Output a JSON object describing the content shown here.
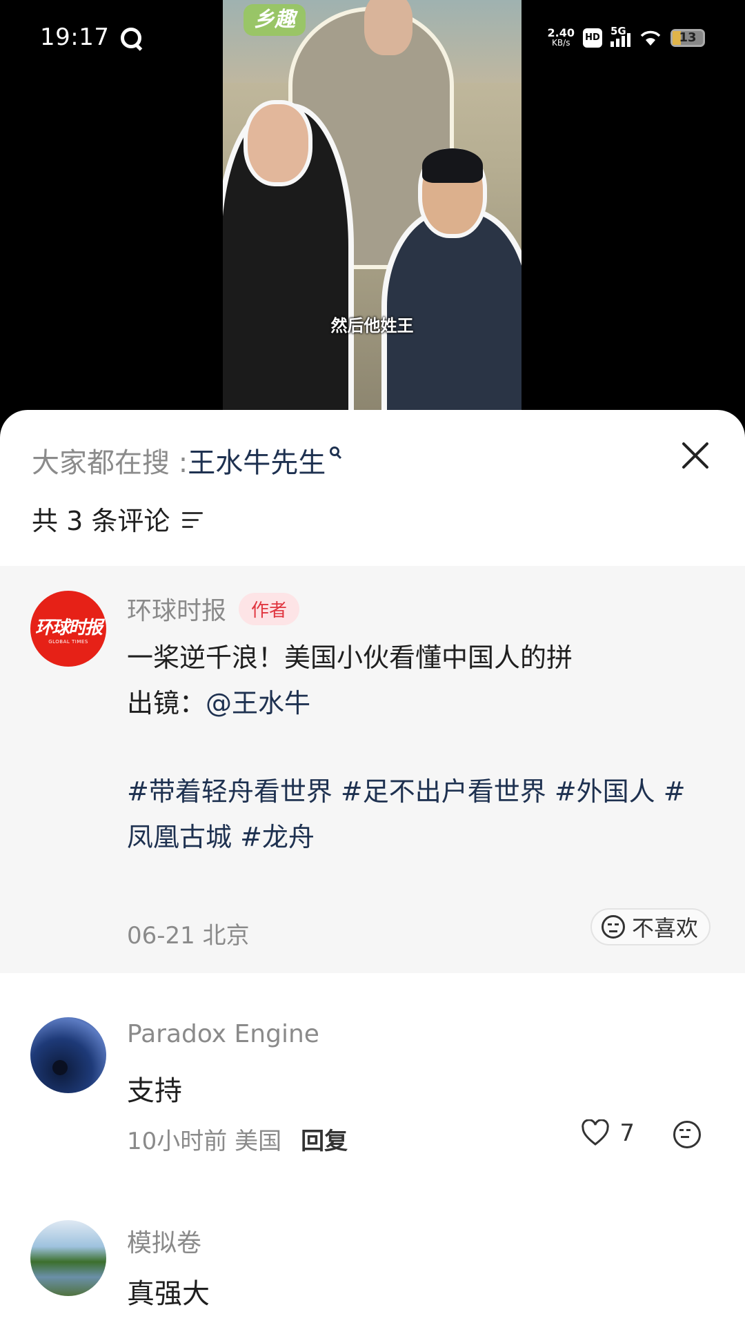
{
  "status_bar": {
    "time": "19:17",
    "net_speed_value": "2.40",
    "net_speed_unit": "KB/s",
    "hd": "HD",
    "network": "5G",
    "battery": "13"
  },
  "video": {
    "logo_text": "乡趣",
    "subtitle": "然后他姓王"
  },
  "sheet": {
    "search_prefix": "大家都在搜 : ",
    "search_term": "王水牛先生",
    "comment_count": "共 3 条评论"
  },
  "post": {
    "avatar_text": "环球时报",
    "avatar_subtext": "GLOBAL TIMES",
    "author": "环球时报",
    "author_badge": "作者",
    "line1": "一桨逆千浪！美国小伙看懂中国人的拼",
    "line2_prefix": "出镜：",
    "line2_mention": "@王水牛",
    "tags_line1": "#带着轻舟看世界 #足不出户看世界 #外国人 #",
    "tags_line2": "凤凰古城 #龙舟",
    "meta": "06-21 北京",
    "dislike_label": "不喜欢"
  },
  "comments": [
    {
      "name": "Paradox Engine",
      "text": "支持",
      "time": "10小时前",
      "location": "美国",
      "reply_label": "回复",
      "likes": "7"
    },
    {
      "name": "模拟卷",
      "text": "真强大"
    }
  ],
  "colors": {
    "link": "#1e3150",
    "author_badge_bg": "#fde4e6",
    "author_badge_fg": "#e0353f",
    "post_bg": "#f6f6f6"
  }
}
